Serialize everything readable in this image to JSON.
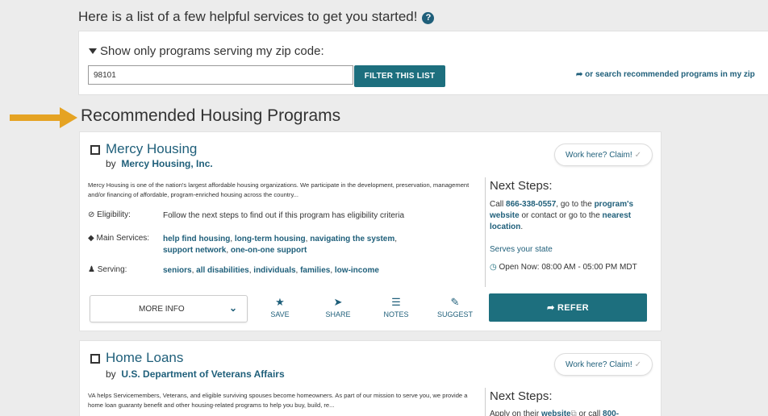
{
  "intro": {
    "text": "Here is a list of a few helpful services to get you started!",
    "help_icon": "?"
  },
  "filter": {
    "label": "Show only programs serving my zip code:",
    "zip_value": "98101",
    "button_label": "FILTER THIS LIST",
    "search_link": "or search recommended programs in my zip"
  },
  "section_title": "Recommended Housing Programs",
  "colors": {
    "accent": "#1d6f7e",
    "link": "#1f5f7a",
    "arrow": "#e5a323"
  },
  "programs": [
    {
      "title": "Mercy Housing",
      "by_prefix": "by",
      "org": "Mercy Housing, Inc.",
      "claim_label": "Work here? Claim!",
      "description": "Mercy Housing is one of the nation's largest affordable housing organizations. We participate in the development, preservation, management and/or financing of affordable, program-enriched housing across the country...",
      "eligibility_label": "Eligibility:",
      "eligibility_value": "Follow the next steps to find out if this program has eligibility criteria",
      "services_label": "Main Services:",
      "services": [
        "help find housing",
        "long-term housing",
        "navigating the system",
        "support network",
        "one-on-one support"
      ],
      "serving_label": "Serving:",
      "serving": [
        "seniors",
        "all disabilities",
        "individuals",
        "families",
        "low-income"
      ],
      "next_steps_title": "Next Steps:",
      "next_call": "Call",
      "next_phone": "866-338-0557",
      "next_goto": ", go to the",
      "next_program_website": "program's website",
      "next_or_contact": "or contact or go to the",
      "next_nearest": "nearest location",
      "next_period": ".",
      "serves_state": "Serves your state",
      "hours": "Open Now: 08:00 AM - 05:00 PM MDT",
      "more_info": "MORE INFO",
      "actions": [
        "SAVE",
        "SHARE",
        "NOTES",
        "SUGGEST"
      ],
      "refer": "REFER"
    },
    {
      "title": "Home Loans",
      "by_prefix": "by",
      "org": "U.S. Department of Veterans Affairs",
      "claim_label": "Work here? Claim!",
      "description": "VA helps Servicemembers, Veterans, and eligible surviving spouses become homeowners. As part of our mission to serve you, we provide a home loan guaranty benefit and other housing-related programs to help you buy, build, re...",
      "next_steps_title": "Next Steps:",
      "next_apply": "Apply on their",
      "next_website": "website",
      "next_or_call": "or call",
      "next_phone_partial": "800-"
    }
  ]
}
